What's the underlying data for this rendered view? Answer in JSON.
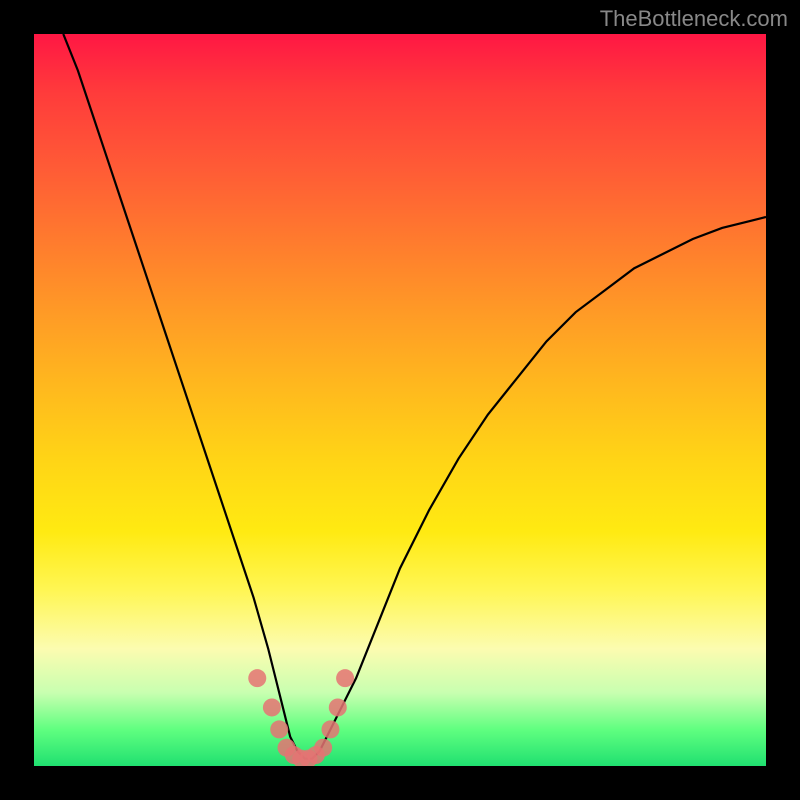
{
  "watermark": "TheBottleneck.com",
  "chart_data": {
    "type": "line",
    "title": "",
    "xlabel": "",
    "ylabel": "",
    "xlim": [
      0,
      100
    ],
    "ylim": [
      0,
      100
    ],
    "series": [
      {
        "name": "bottleneck-curve",
        "x": [
          4,
          6,
          8,
          10,
          12,
          14,
          16,
          18,
          20,
          22,
          24,
          26,
          28,
          30,
          32,
          33,
          34,
          35,
          36,
          37,
          38,
          39,
          40,
          42,
          44,
          46,
          48,
          50,
          54,
          58,
          62,
          66,
          70,
          74,
          78,
          82,
          86,
          90,
          94,
          98,
          100
        ],
        "y": [
          100,
          95,
          89,
          83,
          77,
          71,
          65,
          59,
          53,
          47,
          41,
          35,
          29,
          23,
          16,
          12,
          8,
          4,
          2,
          1,
          1,
          2,
          4,
          8,
          12,
          17,
          22,
          27,
          35,
          42,
          48,
          53,
          58,
          62,
          65,
          68,
          70,
          72,
          73.5,
          74.5,
          75
        ]
      }
    ],
    "markers": {
      "name": "highlight-points",
      "x": [
        30.5,
        32.5,
        33.5,
        34.5,
        35.5,
        36.5,
        37.5,
        38.5,
        39.5,
        40.5,
        41.5,
        42.5
      ],
      "y": [
        12,
        8,
        5,
        2.5,
        1.5,
        1,
        1,
        1.5,
        2.5,
        5,
        8,
        12
      ]
    }
  },
  "colors": {
    "background": "#000000",
    "curve": "#000000",
    "marker": "#e57373"
  }
}
